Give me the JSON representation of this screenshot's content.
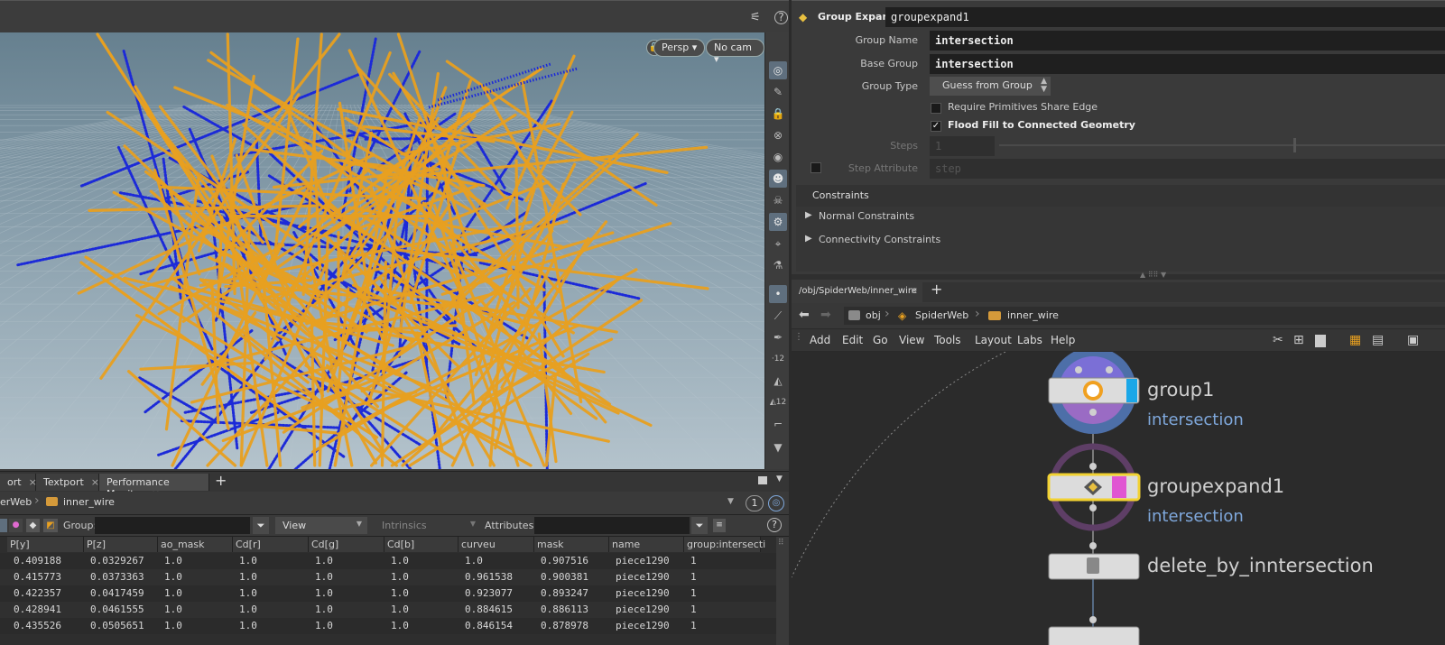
{
  "viewport": {
    "persp_label": "Persp",
    "cam_label": "No cam"
  },
  "bottom_tabs": [
    {
      "label": "ort"
    },
    {
      "label": "Textport"
    },
    {
      "label": "Performance Monitor"
    }
  ],
  "spreadsheet": {
    "path": {
      "parent": "erWeb",
      "node": "inner_wire"
    },
    "badge": "1",
    "group_label": "Group:",
    "view_label": "View",
    "intrinsics_label": "Intrinsics",
    "attributes_label": "Attributes:",
    "columns": [
      "P[y]",
      "P[z]",
      "ao_mask",
      "Cd[r]",
      "Cd[g]",
      "Cd[b]",
      "curveu",
      "mask",
      "name",
      "group:intersecti"
    ],
    "rows": [
      [
        "0.409188",
        "0.0329267",
        "1.0",
        "1.0",
        "1.0",
        "1.0",
        "1.0",
        "0.907516",
        "piece1290",
        "1"
      ],
      [
        "0.415773",
        "0.0373363",
        "1.0",
        "1.0",
        "1.0",
        "1.0",
        "0.961538",
        "0.900381",
        "piece1290",
        "1"
      ],
      [
        "0.422357",
        "0.0417459",
        "1.0",
        "1.0",
        "1.0",
        "1.0",
        "0.923077",
        "0.893247",
        "piece1290",
        "1"
      ],
      [
        "0.428941",
        "0.0461555",
        "1.0",
        "1.0",
        "1.0",
        "1.0",
        "0.884615",
        "0.886113",
        "piece1290",
        "1"
      ],
      [
        "0.435526",
        "0.0505651",
        "1.0",
        "1.0",
        "1.0",
        "1.0",
        "0.846154",
        "0.878978",
        "piece1290",
        "1"
      ]
    ]
  },
  "params": {
    "node_type": "Group Expand",
    "node_name": "groupexpand1",
    "group_name_label": "Group Name",
    "group_name_value": "intersection",
    "base_group_label": "Base Group",
    "base_group_value": "intersection",
    "group_type_label": "Group Type",
    "group_type_value": "Guess from Group",
    "require_prims_label": "Require Primitives Share Edge",
    "flood_fill_label": "Flood Fill to Connected Geometry",
    "steps_label": "Steps",
    "steps_value": "1",
    "step_attr_label": "Step Attribute",
    "step_attr_value": "step",
    "constraints_label": "Constraints",
    "normal_constraints_label": "Normal Constraints",
    "connectivity_constraints_label": "Connectivity Constraints"
  },
  "network": {
    "tab_label": "/obj/SpiderWeb/inner_wire",
    "path": [
      "obj",
      "SpiderWeb",
      "inner_wire"
    ],
    "menu": [
      "Add",
      "Edit",
      "Go",
      "View",
      "Tools",
      "Layout",
      "Labs",
      "Help"
    ],
    "nodes": [
      {
        "name": "group1",
        "sub": "intersection"
      },
      {
        "name": "groupexpand1",
        "sub": "intersection"
      },
      {
        "name": "delete_by_inntersection",
        "sub": ""
      }
    ]
  },
  "colors": {
    "curve_orange": "#e8a020",
    "curve_blue": "#1c2ad8",
    "accent_blue": "#7fa8dc",
    "node_selected": "#f2d232",
    "group1_flag": "#1aa7e8",
    "groupexpand_flag": "#e055d2"
  }
}
